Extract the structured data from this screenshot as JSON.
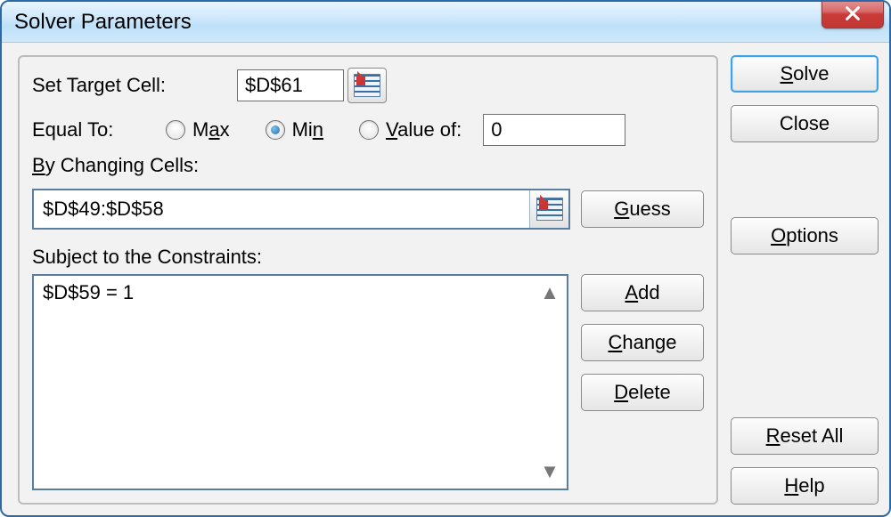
{
  "window": {
    "title": "Solver Parameters"
  },
  "labels": {
    "setTarget": "Set Target Cell:",
    "equalTo": "Equal To:",
    "max_pre": "M",
    "max_ul": "a",
    "max_post": "x",
    "min_pre": "Mi",
    "min_ul": "n",
    "min_post": "",
    "valueof_pre": "",
    "valueof_ul": "V",
    "valueof_post": "alue of:",
    "byChanging_pre": "",
    "byChanging_ul": "B",
    "byChanging_post": "y Changing Cells:",
    "subject": "Subject to the Constraints:"
  },
  "values": {
    "targetCell": "$D$61",
    "valueOf": "0",
    "changingCells": "$D$49:$D$58",
    "constraints": [
      "$D$59 = 1"
    ],
    "equalToSelected": "min"
  },
  "buttons": {
    "solve_ul": "S",
    "solve_post": "olve",
    "close": "Close",
    "options_ul": "O",
    "options_post": "ptions",
    "resetAll_pre": "",
    "resetAll_ul": "R",
    "resetAll_post": "eset All",
    "help_ul": "H",
    "help_post": "elp",
    "guess_ul": "G",
    "guess_post": "uess",
    "add_ul": "A",
    "add_post": "dd",
    "change_ul": "C",
    "change_post": "hange",
    "delete_ul": "D",
    "delete_post": "elete"
  }
}
